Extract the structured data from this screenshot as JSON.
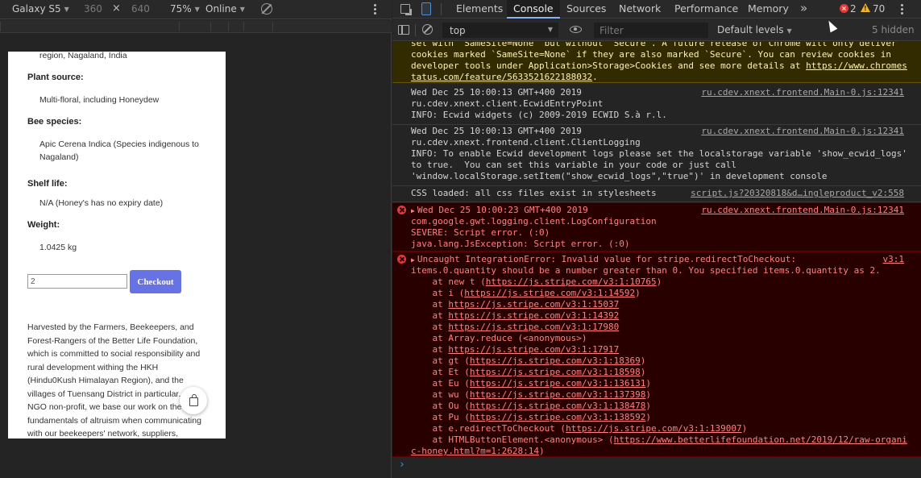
{
  "device_toolbar": {
    "device": "Galaxy S5",
    "width": "360",
    "times": "×",
    "height": "640",
    "zoom": "75%",
    "network": "Online",
    "icons": [
      "rotate-icon",
      "kebab-menu-icon"
    ]
  },
  "page": {
    "region_line": "region, Nagaland, India",
    "plant_label": "Plant source:",
    "plant_value": "Multi-floral, including Honeydew",
    "bee_label": "Bee species:",
    "bee_value": "Apic Cerena Indica (Species indigenous to Nagaland)",
    "shelf_label": "Shelf life:",
    "shelf_value": "N/A (Honey's has no expiry date)",
    "weight_label": "Weight:",
    "weight_value": "1.0425 kg",
    "quantity": "2",
    "checkout_label": "Checkout",
    "description": "Harvested by the Farmers, Beekeepers, and Forest-Rangers of the Better Life Foundation, which is committed to social responsibility and rural development withing the HKH (Hindu0Kush Himalayan Region), and the villages of Tuensang District in particular. As an NGO non-profit, we base our work on the fundamentals of altruism when communicating with our beekeepers' network, suppliers,",
    "icons": [
      "cart-bag-icon"
    ]
  },
  "devtools": {
    "tabs": [
      "Elements",
      "Console",
      "Sources",
      "Network",
      "Performance",
      "Memory"
    ],
    "active_tab": "Console",
    "more_tabs": "»",
    "error_count": "2",
    "warning_count": "70",
    "context": "top",
    "filter_placeholder": "Filter",
    "levels": "Default levels",
    "hidden": "5 hidden",
    "icons": [
      "inspect-icon",
      "device-toolbar-icon",
      "sidebar-icon",
      "clear-console-icon",
      "eye-icon",
      "error-icon",
      "warning-icon"
    ]
  },
  "console": {
    "warning": {
      "lines": [
        "set with `SameSite=None` but without `Secure`. A future release of Chrome will only deliver",
        "cookies marked `SameSite=None` if they are also marked `Secure`. You can review cookies in",
        "developer tools under Application>Storage>Cookies and see more details at "
      ],
      "link_1": "https://www.chromes",
      "link_2": "tatus.com/feature/5633521622188032",
      "link_2_suffix": "."
    },
    "info_1": {
      "lines": [
        "Wed Dec 25 10:00:13 GMT+400 2019",
        "ru.cdev.xnext.client.EcwidEntryPoint",
        "INFO: Ecwid widgets (c) 2009-2019 ECWID S.à r.l."
      ],
      "source": "ru.cdev.xnext.frontend.Main-0.js:12341"
    },
    "info_2": {
      "lines": [
        "Wed Dec 25 10:00:13 GMT+400 2019",
        "ru.cdev.xnext.frontend.client.ClientLogging",
        "INFO: To enable Ecwid development logs please set the localstorage variable 'show_ecwid_logs'",
        "to true.  You can set this variable in your code or just call",
        "'window.localStorage.setItem(\"show_ecwid_logs\",\"true\")' in development console"
      ],
      "source": "ru.cdev.xnext.frontend.Main-0.js:12341"
    },
    "info_3": {
      "lines": [
        "CSS loaded: all css files exist in stylesheets"
      ],
      "source": "script.js?20320818&d…ingleproduct_v2:558"
    },
    "error_1": {
      "lines": [
        "Wed Dec 25 10:00:23 GMT+400 2019",
        "com.google.gwt.logging.client.LogConfiguration",
        "SEVERE: Script error. (:0)",
        "java.lang.JsException: Script error. (:0)"
      ],
      "source": "ru.cdev.xnext.frontend.Main-0.js:12341"
    },
    "error_2": {
      "lines": [
        "Uncaught IntegrationError: Invalid value for stripe.redirectToCheckout:",
        "items.0.quantity should be a number greater than 0. You specified items.0.quantity as 2."
      ],
      "source": "v3:1",
      "stack": [
        {
          "prefix": "    at new t (",
          "link": "https://js.stripe.com/v3:1:10765",
          "suffix": ")"
        },
        {
          "prefix": "    at i (",
          "link": "https://js.stripe.com/v3:1:14592",
          "suffix": ")"
        },
        {
          "prefix": "    at ",
          "link": "https://js.stripe.com/v3:1:15037",
          "suffix": ""
        },
        {
          "prefix": "    at ",
          "link": "https://js.stripe.com/v3:1:14392",
          "suffix": ""
        },
        {
          "prefix": "    at ",
          "link": "https://js.stripe.com/v3:1:17980",
          "suffix": ""
        },
        {
          "prefix": "    at Array.reduce (<anonymous>)",
          "link": "",
          "suffix": ""
        },
        {
          "prefix": "    at ",
          "link": "https://js.stripe.com/v3:1:17917",
          "suffix": ""
        },
        {
          "prefix": "    at gt (",
          "link": "https://js.stripe.com/v3:1:18369",
          "suffix": ")"
        },
        {
          "prefix": "    at Et (",
          "link": "https://js.stripe.com/v3:1:18598",
          "suffix": ")"
        },
        {
          "prefix": "    at Eu (",
          "link": "https://js.stripe.com/v3:1:136131",
          "suffix": ")"
        },
        {
          "prefix": "    at wu (",
          "link": "https://js.stripe.com/v3:1:137398",
          "suffix": ")"
        },
        {
          "prefix": "    at Ou (",
          "link": "https://js.stripe.com/v3:1:138478",
          "suffix": ")"
        },
        {
          "prefix": "    at Pu (",
          "link": "https://js.stripe.com/v3:1:138592",
          "suffix": ")"
        },
        {
          "prefix": "    at e.redirectToCheckout (",
          "link": "https://js.stripe.com/v3:1:139007",
          "suffix": ")"
        },
        {
          "prefix": "    at HTMLButtonElement.<anonymous> (",
          "link": "https://www.betterlifefoundation.net/2019/12/raw-organi",
          "suffix": ""
        },
        {
          "prefix": "",
          "link": "c-honey.html?m=1:2628:14",
          "suffix": ")"
        }
      ]
    },
    "prompt": "›"
  },
  "colors": {
    "checkout": "#6772e5",
    "error_bg": "#290000",
    "error_text": "#ff8080",
    "warn_bg": "#332b00",
    "warn_text": "#fff0b3",
    "accent": "#8ab4f8"
  }
}
